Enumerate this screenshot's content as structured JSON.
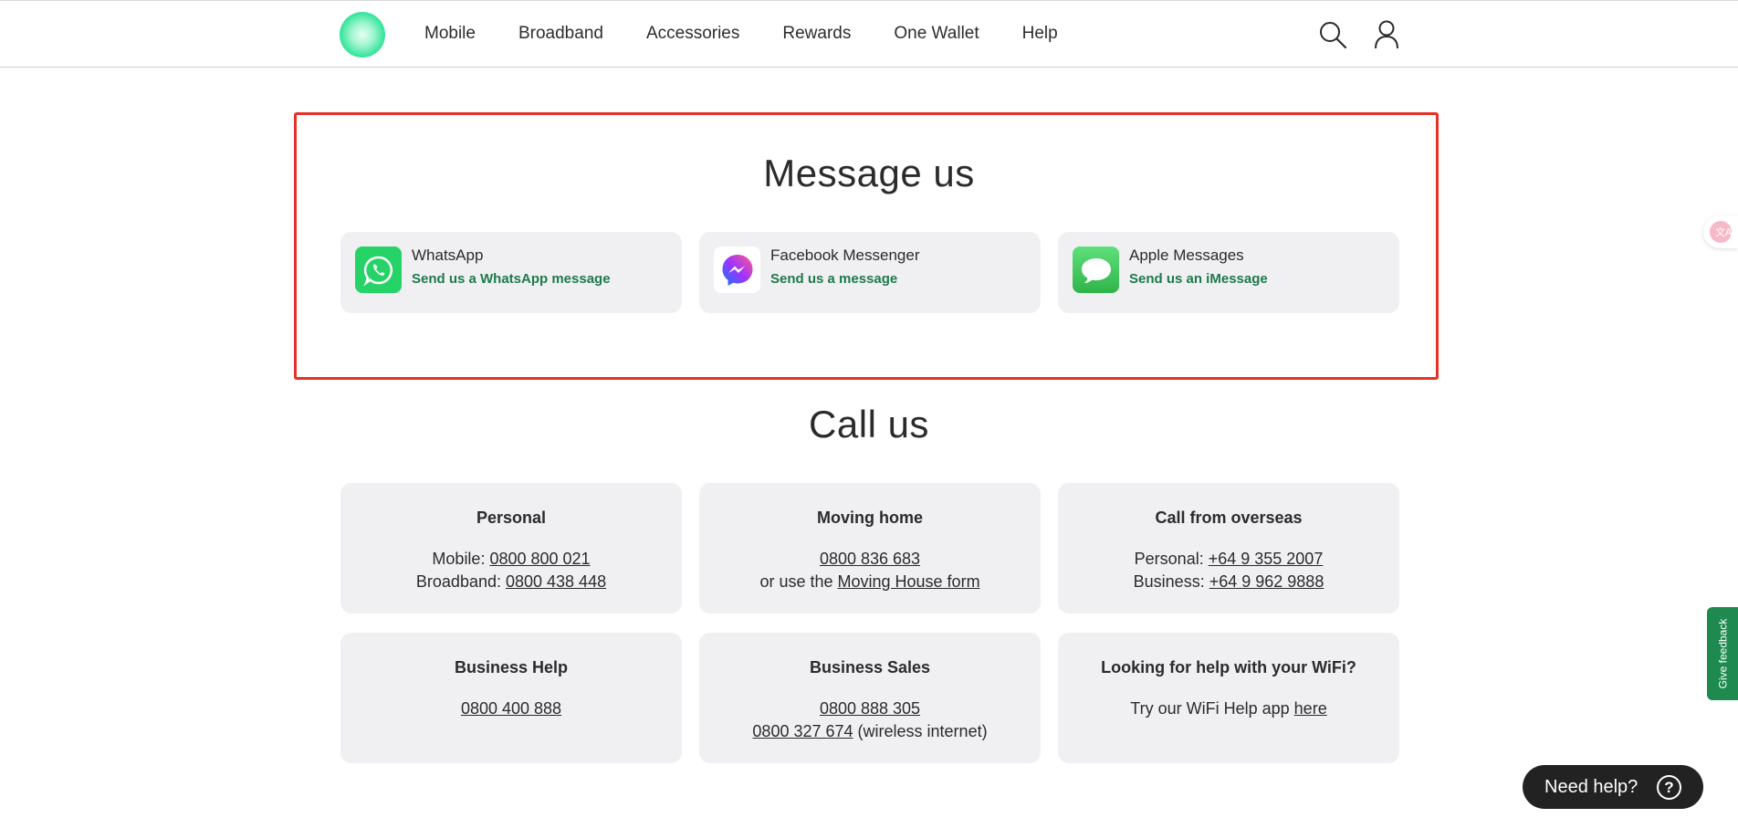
{
  "nav": {
    "items": [
      "Mobile",
      "Broadband",
      "Accessories",
      "Rewards",
      "One Wallet",
      "Help"
    ],
    "search_icon": "search-icon",
    "account_icon": "user-icon"
  },
  "message_section": {
    "title": "Message us",
    "cards": [
      {
        "title": "WhatsApp",
        "link": "Send us a WhatsApp message",
        "icon": "whatsapp-icon",
        "color": "#25d366"
      },
      {
        "title": "Facebook Messenger",
        "link": "Send us a message",
        "icon": "messenger-icon",
        "color": "#8a3ffc"
      },
      {
        "title": "Apple Messages",
        "link": "Send us an iMessage",
        "icon": "imessage-icon",
        "color": "#4cd964"
      }
    ]
  },
  "call_section": {
    "title": "Call us",
    "personal": {
      "title": "Personal",
      "mobile_label": "Mobile: ",
      "mobile_number": "0800 800 021",
      "broadband_label": "Broadband: ",
      "broadband_number": "0800 438 448"
    },
    "moving": {
      "title": "Moving home",
      "number": "0800 836 683",
      "or_text": "or use the ",
      "form_link": "Moving House form"
    },
    "overseas": {
      "title": "Call from overseas",
      "personal_label": "Personal: ",
      "personal_number": "+64 9 355 2007",
      "business_label": "Business: ",
      "business_number": "+64 9 962 9888"
    },
    "business_help": {
      "title": "Business Help",
      "number": "0800 400 888"
    },
    "business_sales": {
      "title": "Business Sales",
      "number": "0800 888 305",
      "wireless_number": "0800 327 674",
      "wireless_suffix": " (wireless internet)"
    },
    "wifi": {
      "title": "Looking for help with your WiFi?",
      "text": "Try our WiFi Help app ",
      "link": "here"
    }
  },
  "feedback_label": "Give feedback",
  "need_help_label": "Need help?",
  "need_help_icon": "?",
  "colors": {
    "accent_green": "#1e7a4a",
    "highlight_red": "#e53227",
    "card_bg": "#f0f0f3"
  }
}
